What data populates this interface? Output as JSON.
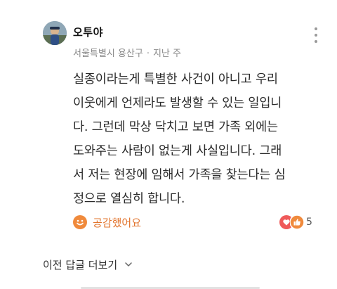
{
  "comment": {
    "author": "오투야",
    "location": "서울특별시 용산구",
    "separator": "·",
    "time": "지난 주",
    "body_lines": [
      "실종이라는게 특별한 사건이 아니고 우리",
      "이웃에게 언제라도 발생할 수 있는 일입니",
      "다. 그런데 막상 닥치고 보면 가족 외에는",
      "도와주는 사람이 없는게 사실입니다. 그래",
      "서 저는 현장에 임해서 가족을 찾는다는 심",
      "정으로 열심히 합니다."
    ],
    "like_label": "공감했어요",
    "reaction_count": "5",
    "icons": {
      "more": "more-vertical-icon",
      "like": "smile-reaction-icon",
      "heart": "heart-reaction-icon",
      "thumb": "thumbs-up-reaction-icon"
    },
    "colors": {
      "accent": "#f08a3c",
      "heart": "#ef5a5a",
      "meta": "#8a8a8a"
    }
  },
  "replies": {
    "prev_label": "이전 답글 더보기",
    "chevron_icon": "chevron-down-icon"
  }
}
